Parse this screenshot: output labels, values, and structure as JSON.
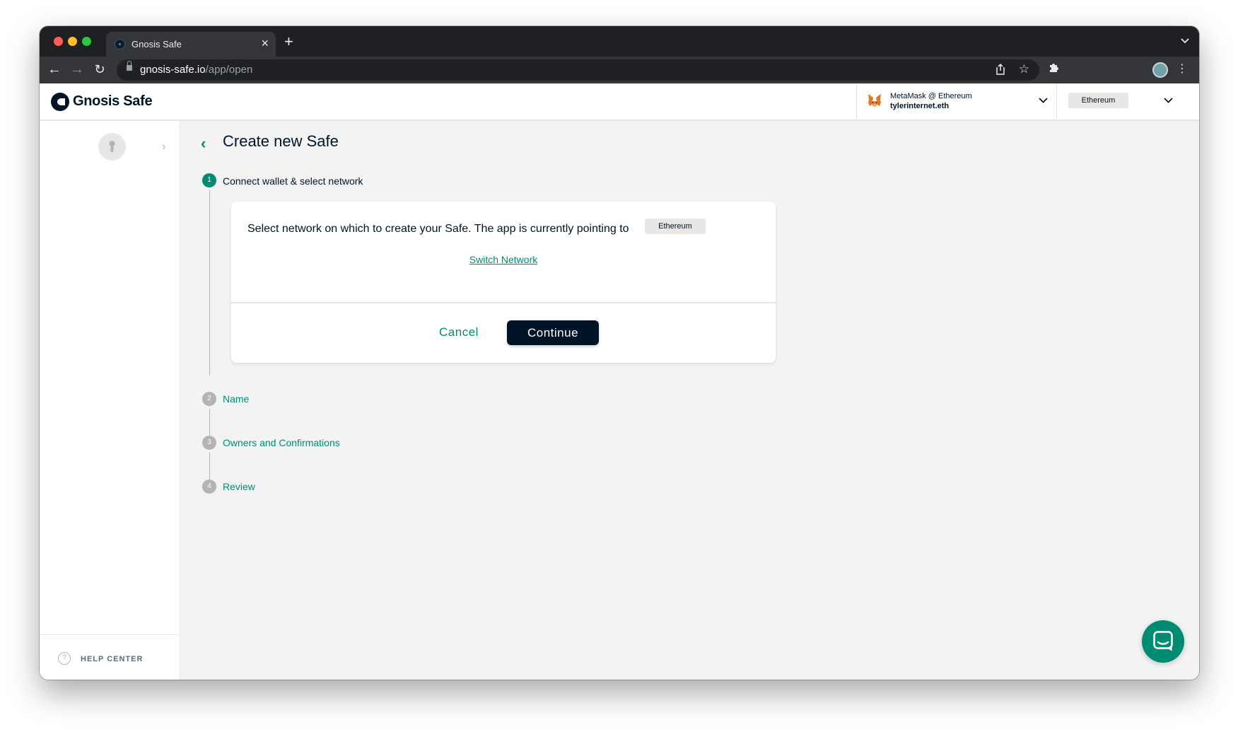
{
  "browser": {
    "tab_title": "Gnosis Safe",
    "url_host": "gnosis-safe.io",
    "url_path": "/app/open"
  },
  "header": {
    "brand": "Gnosis Safe",
    "wallet_provider": "MetaMask @ Ethereum",
    "wallet_name": "tylerinternet.eth",
    "network": "Ethereum"
  },
  "sidebar": {
    "help_label": "HELP CENTER"
  },
  "main": {
    "title": "Create new Safe",
    "steps": [
      {
        "number": "1",
        "label": "Connect wallet & select network"
      },
      {
        "number": "2",
        "label": "Name"
      },
      {
        "number": "3",
        "label": "Owners and Confirmations"
      },
      {
        "number": "4",
        "label": "Review"
      }
    ],
    "card": {
      "text": "Select network on which to create your Safe. The app is currently pointing to",
      "network_chip": "Ethereum",
      "switch_link": "Switch Network",
      "cancel_label": "Cancel",
      "continue_label": "Continue"
    }
  },
  "colors": {
    "accent": "#008c73",
    "primary_dark": "#001428",
    "background": "#f4f3f3"
  }
}
